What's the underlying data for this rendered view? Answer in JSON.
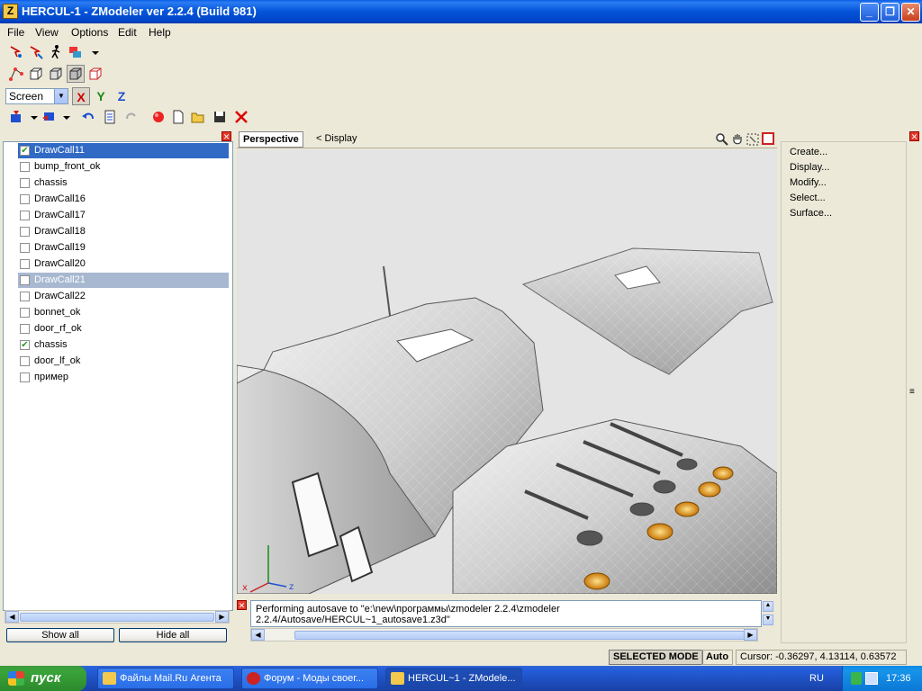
{
  "window": {
    "title": "HERCUL-1 - ZModeler ver 2.2.4 (Build 981)",
    "app_icon_letter": "Z"
  },
  "menu": [
    "File",
    "View",
    "Options",
    "Edit",
    "Help"
  ],
  "toolbar": {
    "coord_space": "Screen",
    "axes": [
      "X",
      "Y",
      "Z"
    ]
  },
  "objects": [
    {
      "name": "DrawCall11",
      "checked": true,
      "state": "highlighted"
    },
    {
      "name": "bump_front_ok",
      "checked": false,
      "state": "normal"
    },
    {
      "name": "chassis",
      "checked": false,
      "state": "normal"
    },
    {
      "name": "DrawCall16",
      "checked": false,
      "state": "normal"
    },
    {
      "name": "DrawCall17",
      "checked": false,
      "state": "normal"
    },
    {
      "name": "DrawCall18",
      "checked": false,
      "state": "normal"
    },
    {
      "name": "DrawCall19",
      "checked": false,
      "state": "normal"
    },
    {
      "name": "DrawCall20",
      "checked": false,
      "state": "normal"
    },
    {
      "name": "DrawCall21",
      "checked": false,
      "state": "selected"
    },
    {
      "name": "DrawCall22",
      "checked": false,
      "state": "normal"
    },
    {
      "name": "bonnet_ok",
      "checked": false,
      "state": "normal"
    },
    {
      "name": "door_rf_ok",
      "checked": false,
      "state": "normal"
    },
    {
      "name": "chassis",
      "checked": true,
      "state": "normal"
    },
    {
      "name": "door_lf_ok",
      "checked": false,
      "state": "normal"
    },
    {
      "name": "пример",
      "checked": false,
      "state": "normal"
    }
  ],
  "left_panel": {
    "show_all": "Show all",
    "hide_all": "Hide all"
  },
  "viewport": {
    "tab": "Perspective",
    "display_label": "< Display",
    "axis_x": "x",
    "axis_z": "z"
  },
  "log": {
    "message": "Performing autosave to \"e:\\new\\программы\\zmodeler 2.2.4\\zmodeler 2.2.4/Autosave/HERCUL~1_autosave1.z3d\""
  },
  "commands": [
    "Create...",
    "Display...",
    "Modify...",
    "Select...",
    "Surface..."
  ],
  "status": {
    "mode": "SELECTED MODE",
    "snap": "Auto",
    "cursor": "Cursor: -0.36297, 4.13114, 0.63572"
  },
  "taskbar": {
    "start": "пуск",
    "tasks": [
      {
        "label": "Файлы Mail.Ru Агента",
        "active": false
      },
      {
        "label": "Форум - Моды своег...",
        "active": false
      },
      {
        "label": "HERCUL~1 - ZModele...",
        "active": true
      }
    ],
    "language": "RU",
    "clock": "17:36"
  }
}
